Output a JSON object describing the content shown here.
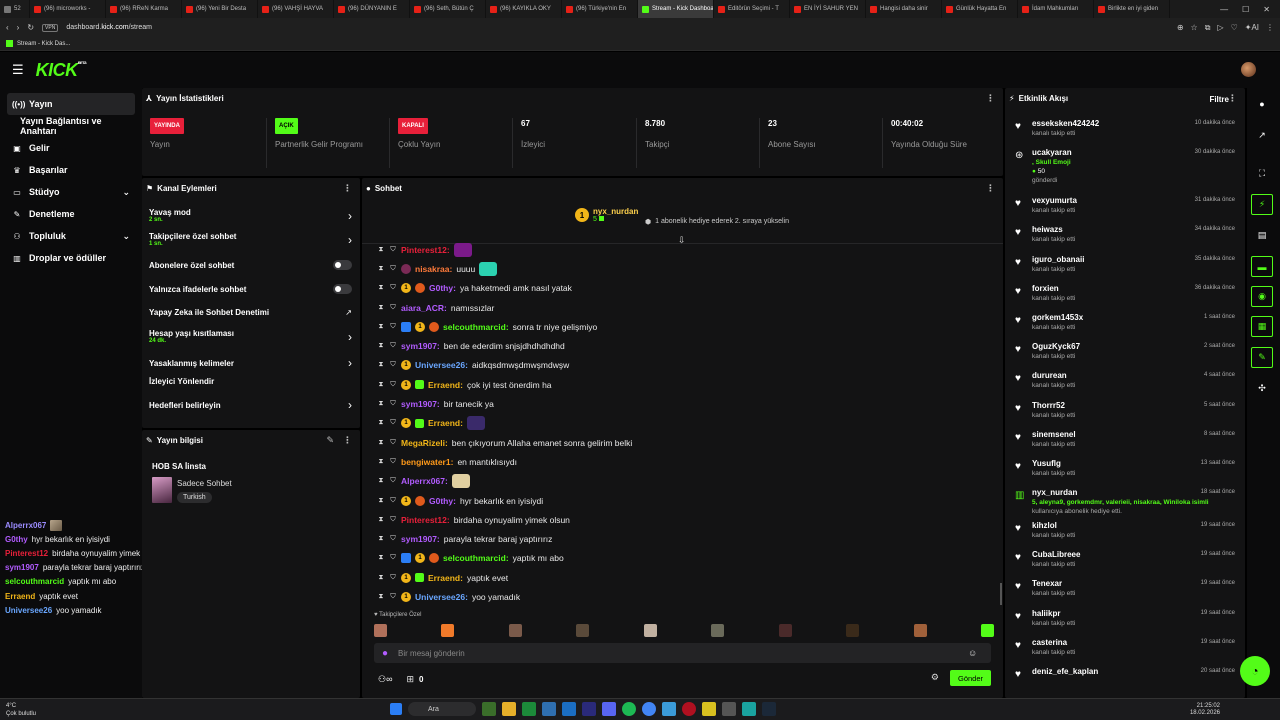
{
  "browser": {
    "tabs": [
      {
        "label": "(96) microworks -",
        "active": false
      },
      {
        "label": "(96) RReN Karma",
        "active": false
      },
      {
        "label": "(96) Yeni Bir Desta",
        "active": false
      },
      {
        "label": "(96) VAHŞİ HAYVA",
        "active": false
      },
      {
        "label": "(96) DÜNYANIN E",
        "active": false
      },
      {
        "label": "(96) Seth, Bütün Ç",
        "active": false
      },
      {
        "label": "(96) KAYIKLA OKY",
        "active": false
      },
      {
        "label": "(96) Türkiye'nin En",
        "active": false
      },
      {
        "label": "Stream - Kick Dashboard",
        "active": true
      },
      {
        "label": "Editörün Seçimi - T",
        "active": false
      },
      {
        "label": "EN İYİ SAHUR YEN",
        "active": false
      },
      {
        "label": "Hangisi daha sinir",
        "active": false
      },
      {
        "label": "Günlük Hayatta En",
        "active": false
      },
      {
        "label": "İdam Mahkumları",
        "active": false
      },
      {
        "label": "Birlikte en iyi giden",
        "active": false
      }
    ],
    "tab_count": "52",
    "url_host": "dashboard.kick.com",
    "url_path": "/stream",
    "url_prefix": "dashboard.",
    "url_domain": "kick.com",
    "chip": "VPN",
    "ai_label": "AI",
    "bookmark": "Stream - Kick Das..."
  },
  "header": {
    "logo": "KICK",
    "logo_sup": "BETA"
  },
  "nav": {
    "items": [
      {
        "label": "Yayın",
        "icon": "broadcast-icon",
        "active": true
      },
      {
        "label": "Yayın Bağlantısı ve Anahtarı",
        "icon": "",
        "sub": true
      },
      {
        "label": "Gelir",
        "icon": "revenue-icon"
      },
      {
        "label": "Başarılar",
        "icon": "trophy-icon"
      },
      {
        "label": "Stüdyo",
        "icon": "studio-icon",
        "chevron": true
      },
      {
        "label": "Denetleme",
        "icon": "wrench-icon"
      },
      {
        "label": "Topluluk",
        "icon": "community-icon",
        "chevron": true
      },
      {
        "label": "Droplar ve ödüller",
        "icon": "gift-icon"
      }
    ]
  },
  "chatlog": [
    {
      "name": "Alperrx067",
      "text": "",
      "color": "#9b8cff",
      "thumb": true
    },
    {
      "name": "G0thy",
      "text": "hyr bekarlık en iyisiydi",
      "color": "#b25cff"
    },
    {
      "name": "Pinterest12",
      "text": "birdaha oynuyalim yimek olsun",
      "color": "#e8203a"
    },
    {
      "name": "sym1907",
      "text": "parayla tekrar baraj yaptırırız",
      "color": "#b25cff"
    },
    {
      "name": "selcouthmarcid",
      "text": "yaptık mı abo",
      "color": "#53fc18"
    },
    {
      "name": "Erraend",
      "text": "yaptık evet",
      "color": "#f2b619"
    },
    {
      "name": "Universee26",
      "text": "yoo yamadık",
      "color": "#6aa7ff"
    }
  ],
  "stats": {
    "title": "Yayın İstatistikleri",
    "items": [
      {
        "badge": "YAYINDA",
        "badge_color": "red",
        "label": "Yayın"
      },
      {
        "badge": "AÇIK",
        "badge_color": "green",
        "label": "Partnerlik Gelir Programı"
      },
      {
        "badge": "KAPALI",
        "badge_color": "red",
        "label": "Çoklu Yayın"
      },
      {
        "value": "67",
        "label": "İzleyici"
      },
      {
        "value": "8.780",
        "label": "Takipçi"
      },
      {
        "value": "23",
        "label": "Abone Sayısı"
      },
      {
        "value": "00:40:02",
        "label": "Yayında Olduğu Süre"
      }
    ]
  },
  "actions": {
    "title": "Kanal Eylemleri",
    "items": [
      {
        "label": "Yavaş mod",
        "sub": "2 sn.",
        "control": "chevron"
      },
      {
        "label": "Takipçilere özel sohbet",
        "sub": "1 sn.",
        "control": "chevron"
      },
      {
        "label": "Abonelere özel sohbet",
        "sub": "",
        "control": "toggle"
      },
      {
        "label": "Yalnızca ifadelerle sohbet",
        "sub": "",
        "control": "toggle"
      },
      {
        "label": "Yapay Zeka ile Sohbet Denetimi",
        "sub": "",
        "control": "external"
      },
      {
        "label": "Hesap yaşı kısıtlaması",
        "sub": "24 dk.",
        "control": "chevron"
      },
      {
        "label": "Yasaklanmış kelimeler",
        "sub": "",
        "control": "chevron"
      },
      {
        "label": "İzleyici Yönlendir",
        "sub": "",
        "control": "none"
      },
      {
        "label": "Hedefleri belirleyin",
        "sub": "",
        "control": "chevron"
      }
    ]
  },
  "info": {
    "title": "Yayın bilgisi",
    "stream_title": "HOB SA İinsta",
    "category": "Sadece Sohbet",
    "tag": "Turkish"
  },
  "chat": {
    "title": "Sohbet",
    "pinned_user": "nyx_nurdan",
    "pinned_count": "5",
    "pinned_badge": "1",
    "pinned_msg": "1 abonelik hediye ederek 2. sıraya yükselin",
    "messages": [
      {
        "badges": [
          "mod",
          "vip"
        ],
        "name": "Pinterest12",
        "color": "#e8203a",
        "text": "",
        "emote": "#7b1a8a"
      },
      {
        "badges": [
          "mod",
          "vip",
          "rose"
        ],
        "name": "nisakraa",
        "color": "#ff7a3a",
        "text": "uuuu",
        "emote": "#2bd1b0"
      },
      {
        "badges": [
          "mod",
          "vip",
          "sub",
          "wolf"
        ],
        "name": "G0thy",
        "color": "#b25cff",
        "text": "ya haketmedi amk nasıl yatak"
      },
      {
        "badges": [
          "mod",
          "vip"
        ],
        "name": "aiara_ACR",
        "color": "#b25cff",
        "text": "namıssızlar"
      },
      {
        "badges": [
          "mod",
          "vip",
          "bolt",
          "sub",
          "wolf"
        ],
        "name": "selcouthmarcid",
        "color": "#53fc18",
        "text": "sonra tr niye gelişmiyo"
      },
      {
        "badges": [
          "mod",
          "vip"
        ],
        "name": "sym1907",
        "color": "#b25cff",
        "text": "ben de ederdim snjsjdhdhdhdhd"
      },
      {
        "badges": [
          "mod",
          "vip",
          "sub"
        ],
        "name": "Universee26",
        "color": "#6aa7ff",
        "text": "aidkqsdmwşdmwşmdwşw"
      },
      {
        "badges": [
          "mod",
          "vip",
          "sub",
          "gift"
        ],
        "name": "Erraend",
        "color": "#f2b619",
        "text": "çok iyi test önerdim ha"
      },
      {
        "badges": [
          "mod",
          "vip"
        ],
        "name": "sym1907",
        "color": "#b25cff",
        "text": "bir tanecik ya"
      },
      {
        "badges": [
          "mod",
          "vip",
          "sub",
          "gift"
        ],
        "name": "Erraend",
        "color": "#f2b619",
        "text": "",
        "emote": "#3a2a6a"
      },
      {
        "badges": [
          "mod",
          "vip"
        ],
        "name": "MegaRizeli",
        "color": "#f2b619",
        "text": "ben çıkıyorum Allaha emanet sonra gelirim belki"
      },
      {
        "badges": [
          "mod",
          "vip"
        ],
        "name": "bengiwater1",
        "color": "#ff9a1a",
        "text": "en mantıklısıydı"
      },
      {
        "badges": [
          "mod",
          "vip"
        ],
        "name": "Alperrx067",
        "color": "#b25cff",
        "text": "",
        "emote": "#e0cfa0"
      },
      {
        "badges": [
          "mod",
          "vip",
          "sub",
          "wolf"
        ],
        "name": "G0thy",
        "color": "#b25cff",
        "text": "hyr bekarlık en iyisiydi"
      },
      {
        "badges": [
          "mod",
          "vip"
        ],
        "name": "Pinterest12",
        "color": "#e8203a",
        "text": "birdaha oynuyalim yimek olsun"
      },
      {
        "badges": [
          "mod",
          "vip"
        ],
        "name": "sym1907",
        "color": "#b25cff",
        "text": "parayla tekrar baraj yaptırırız"
      },
      {
        "badges": [
          "mod",
          "vip",
          "bolt",
          "sub",
          "wolf"
        ],
        "name": "selcouthmarcid",
        "color": "#53fc18",
        "text": "yaptık mı abo"
      },
      {
        "badges": [
          "mod",
          "vip",
          "sub",
          "gift"
        ],
        "name": "Erraend",
        "color": "#f2b619",
        "text": "yaptık evet"
      },
      {
        "badges": [
          "mod",
          "vip",
          "sub"
        ],
        "name": "Universee26",
        "color": "#6aa7ff",
        "text": "yoo yamadık"
      }
    ],
    "emote_label": "Takipçilere Özel",
    "input_placeholder": "Bir mesaj gönderin",
    "footer_count": "0",
    "send_label": "Gönder"
  },
  "activity": {
    "title": "Etkinlik Akışı",
    "filter": "Filtre",
    "events": [
      {
        "user": "esseksken424242",
        "desc": "kanalı takip etti",
        "time": "10 dakika önce",
        "icon": "heart-icon"
      },
      {
        "user": "ucakyaran",
        "desc": "gönderdi",
        "time": "30 dakika önce",
        "icon": "kick-coin-icon",
        "extra": ", Skull Emoji",
        "amount": "50",
        "tall": true
      },
      {
        "user": "vexyumurta",
        "desc": "kanalı takip etti",
        "time": "31 dakika önce",
        "icon": "heart-icon"
      },
      {
        "user": "heiwazs",
        "desc": "kanalı takip etti",
        "time": "34 dakika önce",
        "icon": "heart-icon"
      },
      {
        "user": "iguro_obanaii",
        "desc": "kanalı takip etti",
        "time": "35 dakika önce",
        "icon": "heart-icon"
      },
      {
        "user": "forxien",
        "desc": "kanalı takip etti",
        "time": "36 dakika önce",
        "icon": "heart-icon"
      },
      {
        "user": "gorkem1453x",
        "desc": "kanalı takip etti",
        "time": "1 saat önce",
        "icon": "heart-icon"
      },
      {
        "user": "OguzKyck67",
        "desc": "kanalı takip etti",
        "time": "2 saat önce",
        "icon": "heart-icon"
      },
      {
        "user": "dururean",
        "desc": "kanalı takip etti",
        "time": "4 saat önce",
        "icon": "heart-icon"
      },
      {
        "user": "Thorrr52",
        "desc": "kanalı takip etti",
        "time": "5 saat önce",
        "icon": "heart-icon"
      },
      {
        "user": "sinemsenel",
        "desc": "kanalı takip etti",
        "time": "8 saat önce",
        "icon": "heart-icon"
      },
      {
        "user": "Yusuflg",
        "desc": "kanalı takip etti",
        "time": "13 saat önce",
        "icon": "heart-icon"
      },
      {
        "user": "nyx_nurdan",
        "desc": "kullanıcıya abonelik hediye etti.",
        "time": "18 saat önce",
        "icon": "gift-icon",
        "extra": "5, aleyna9, gorkemdmr, valerieii, nisakraa, Winiloka isimli",
        "mid": true
      },
      {
        "user": "kihzlol",
        "desc": "kanalı takip etti",
        "time": "19 saat önce",
        "icon": "heart-icon"
      },
      {
        "user": "CubaLibreee",
        "desc": "kanalı takip etti",
        "time": "19 saat önce",
        "icon": "heart-icon"
      },
      {
        "user": "Tenexar",
        "desc": "kanalı takip etti",
        "time": "19 saat önce",
        "icon": "heart-icon"
      },
      {
        "user": "haliikpr",
        "desc": "kanalı takip etti",
        "time": "19 saat önce",
        "icon": "heart-icon"
      },
      {
        "user": "casterina",
        "desc": "kanalı takip etti",
        "time": "19 saat önce",
        "icon": "heart-icon"
      },
      {
        "user": "deniz_efe_kaplan",
        "desc": "",
        "time": "20 saat önce",
        "icon": "heart-icon"
      }
    ]
  },
  "taskbar": {
    "temp": "4°C",
    "weather": "Çok bulutlu",
    "search": "Ara",
    "time": "21:25:02",
    "date": "18.02.2026"
  },
  "colors": {
    "accent": "#53fc18",
    "live": "#e8203a",
    "panel": "#131314"
  }
}
